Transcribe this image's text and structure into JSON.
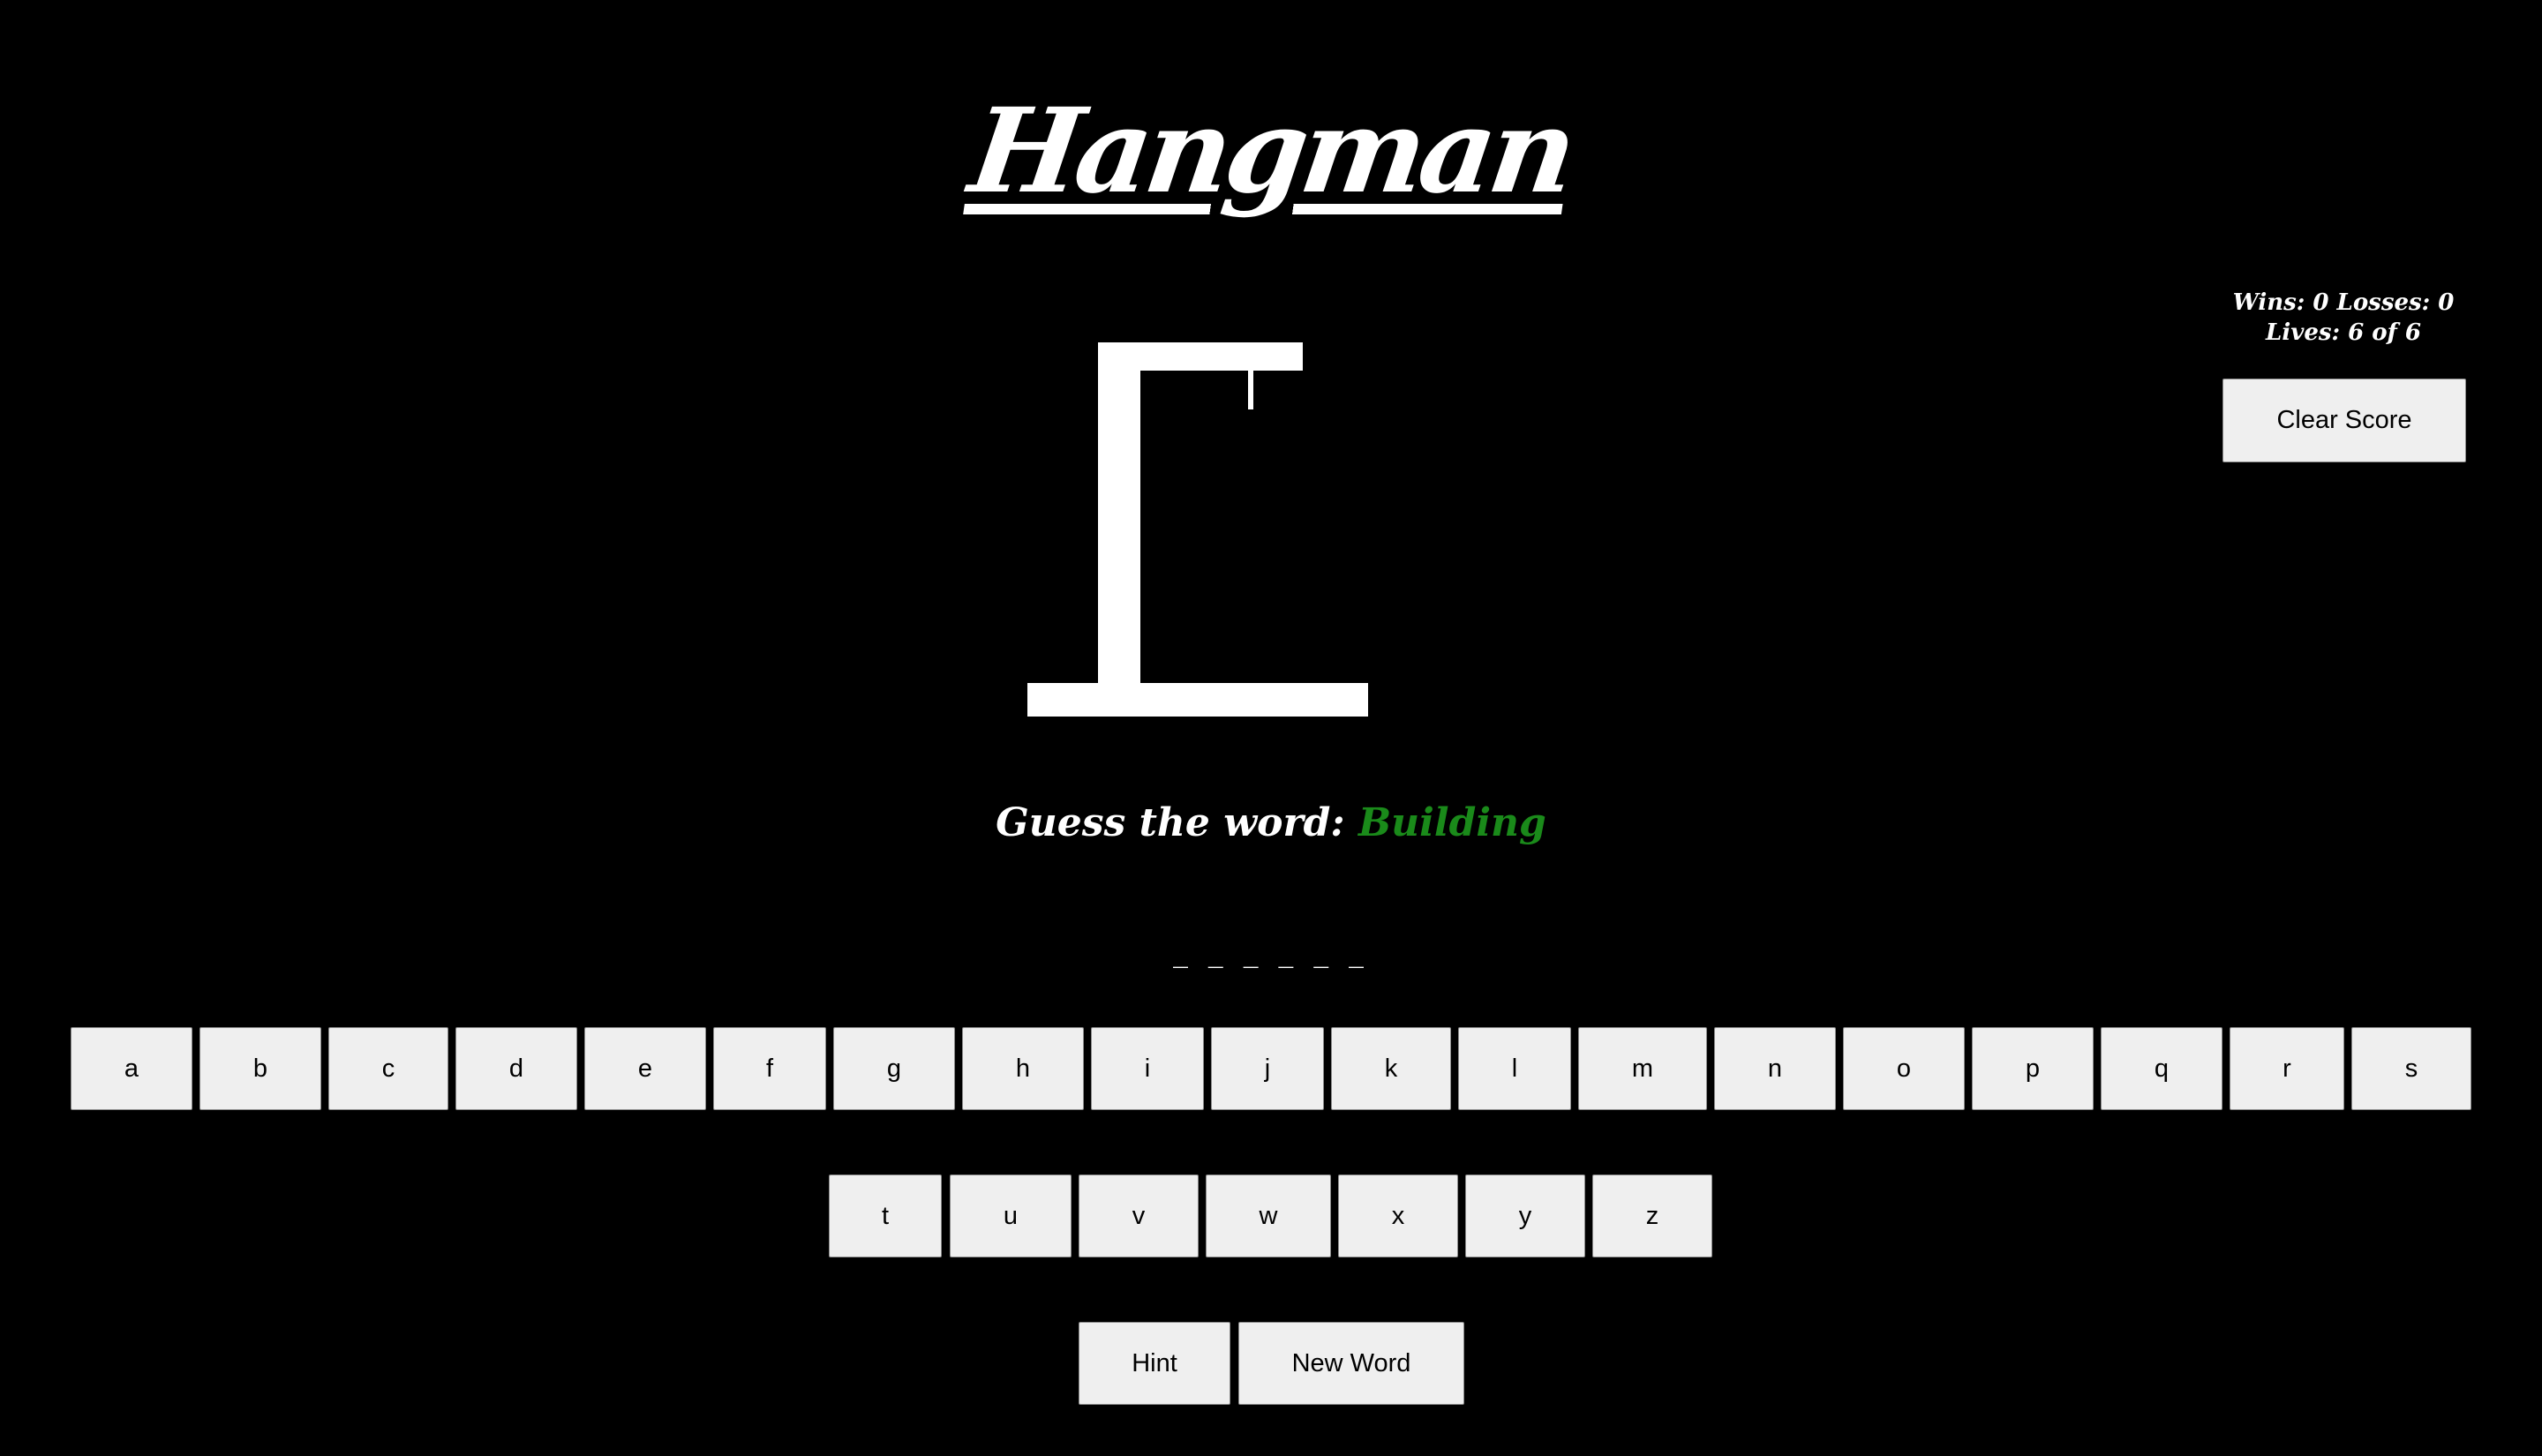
{
  "title": "Hangman",
  "score": {
    "wins_losses": "Wins: 0 Losses: 0",
    "lives": "Lives: 6 of 6",
    "clear_label": "Clear Score"
  },
  "guess": {
    "prompt": "Guess the word: ",
    "category": "Building"
  },
  "blanks": "_ _ _ _ _ _",
  "keyboard": {
    "row1": [
      "a",
      "b",
      "c",
      "d",
      "e",
      "f",
      "g",
      "h",
      "i",
      "j",
      "k",
      "l",
      "m",
      "n",
      "o",
      "p",
      "q",
      "r",
      "s"
    ],
    "row2": [
      "t",
      "u",
      "v",
      "w",
      "x",
      "y",
      "z"
    ]
  },
  "actions": {
    "hint_label": "Hint",
    "new_word_label": "New Word"
  },
  "colors": {
    "background": "#000000",
    "category": "#1a8a1a",
    "button": "#efefef"
  }
}
